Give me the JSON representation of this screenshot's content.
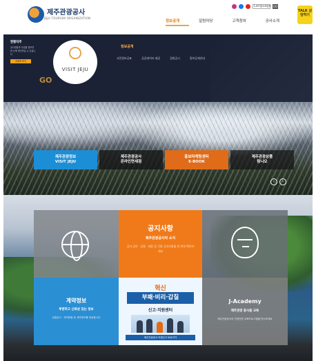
{
  "header": {
    "logo_text": "제주관광공사",
    "logo_sub": "JEJU TOURISM ORGANIZATION",
    "lang_select": "Language",
    "lang_go": "GO",
    "kakao_label": "TALK 상담하기",
    "gnb": [
      {
        "label": "정보공개",
        "active": true
      },
      {
        "label": "알림마당",
        "active": false
      },
      {
        "label": "고객참여",
        "active": false
      },
      {
        "label": "공사소개",
        "active": false
      }
    ]
  },
  "mega": {
    "left_title": "현황자주",
    "left_desc": "공사현황과 사업별 정보를 한 눈에 확인하실 수 있습니다",
    "left_button": "자세히 보기",
    "visit_label": "VISIT JEJU",
    "go_tag": "GO",
    "section_title": "정보공개",
    "links": [
      "사전정보공표",
      "공공데이터 제공",
      "경영공시",
      "정보공개안내"
    ]
  },
  "hero": {
    "caption": "",
    "quick_links": [
      {
        "line1": "제주관광정보",
        "line2": "VISIT JEJU"
      },
      {
        "line1": "제주관광공사",
        "line2": "온라인면세점"
      },
      {
        "line1": "홍보마케팅센터",
        "line2": "E-BOOK"
      },
      {
        "line1": "제주관광상품",
        "line2": "탐나오"
      }
    ],
    "prev": "‹",
    "next": "›"
  },
  "tiles": {
    "notice": {
      "title": "공지사항",
      "subtitle": "제주관광공사의 소식",
      "desc": "공사 공모 · 입찰 · 채용 등 각종 공지사항을 한 번에 확인하세요"
    },
    "contract": {
      "title": "계약정보",
      "subtitle": "투명하고 신뢰성 있는 정보",
      "desc": "입찰공고 · 계약현황 등 계약정보를 제공합니다"
    },
    "campaign": {
      "top": "혁신",
      "middle": "부패·비리·갑질",
      "sub": "신고·지원센터",
      "foot": "제주관광공사 익명신고 바로가기"
    },
    "academy": {
      "title": "J-Academy",
      "subtitle": "제주관광 종사원 교육",
      "desc": "제주관광공사의 관광전문 교육프로그램을 만나보세요"
    }
  },
  "colors": {
    "accent_orange": "#f07a1a",
    "accent_blue": "#2b8fd3",
    "nav_dark": "#1b2236",
    "kakao_yellow": "#f6d31a"
  }
}
